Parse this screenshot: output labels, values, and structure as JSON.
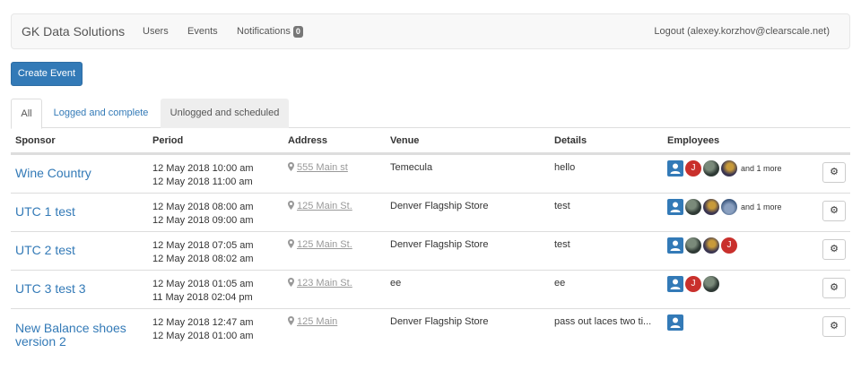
{
  "navbar": {
    "brand": "GK Data Solutions",
    "links": {
      "users": "Users",
      "events": "Events",
      "notifications": "Notifications"
    },
    "notifications_count": "0",
    "logout": "Logout (alexey.korzhov@clearscale.net)"
  },
  "create_event_label": "Create Event",
  "tabs": {
    "all": "All",
    "logged": "Logged and complete",
    "unlogged": "Unlogged and scheduled"
  },
  "table": {
    "headers": {
      "sponsor": "Sponsor",
      "period": "Period",
      "address": "Address",
      "venue": "Venue",
      "details": "Details",
      "employees": "Employees"
    },
    "rows": [
      {
        "sponsor": "Wine Country",
        "start": "12 May 2018 10:00 am",
        "end": "12 May 2018 11:00 am",
        "address": "555 Main st",
        "venue": "Temecula",
        "details": "hello",
        "more": "and 1 more"
      },
      {
        "sponsor": "UTC 1 test",
        "start": "12 May 2018 08:00 am",
        "end": "12 May 2018 09:00 am",
        "address": "125 Main St.",
        "venue": "Denver Flagship Store",
        "details": "test",
        "more": "and 1 more"
      },
      {
        "sponsor": "UTC 2 test",
        "start": "12 May 2018 07:05 am",
        "end": "12 May 2018 08:02 am",
        "address": "125 Main St.",
        "venue": "Denver Flagship Store",
        "details": "test"
      },
      {
        "sponsor": "UTC 3 test 3",
        "start": "12 May 2018 01:05 am",
        "end": "11 May 2018 02:04 pm",
        "address": "123 Main St.",
        "venue": "ee",
        "details": "ee"
      },
      {
        "sponsor": "New Balance shoes version 2",
        "start": "12 May 2018 12:47 am",
        "end": "12 May 2018 01:00 am",
        "address": "125 Main",
        "venue": "Denver Flagship Store",
        "details": "pass out laces two ti..."
      }
    ]
  },
  "avatar_letter": "J",
  "icons": {
    "pin": "map-marker-icon",
    "user": "user-icon",
    "gear": "gear-icon"
  },
  "colors": {
    "primary": "#337ab7",
    "avatar_j": "#c9302c",
    "badge": "#777777"
  }
}
